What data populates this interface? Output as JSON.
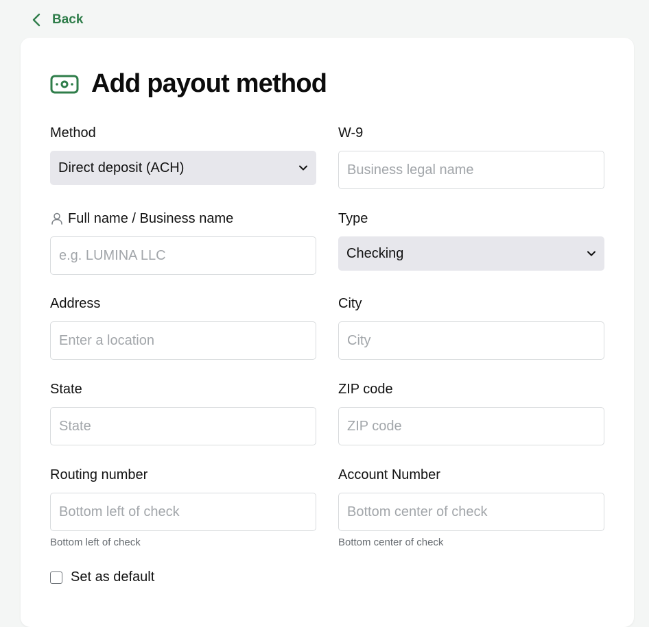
{
  "back": {
    "label": "Back"
  },
  "page": {
    "title": "Add payout method"
  },
  "colors": {
    "accent": "#2f7d4a",
    "select_bg": "#e7e7ec"
  },
  "icons": {
    "back": "chevron-left-icon",
    "title": "money-bill-icon",
    "name_label": "user-icon",
    "select": "chevron-down-icon"
  },
  "form": {
    "method": {
      "label": "Method",
      "value": "Direct deposit (ACH)"
    },
    "w9": {
      "label": "W-9",
      "value": "",
      "placeholder": "Business legal name"
    },
    "full_name": {
      "label": "Full name / Business name",
      "value": "",
      "placeholder": "e.g. LUMINA LLC"
    },
    "type": {
      "label": "Type",
      "value": "Checking"
    },
    "address": {
      "label": "Address",
      "value": "",
      "placeholder": "Enter a location"
    },
    "city": {
      "label": "City",
      "value": "",
      "placeholder": "City"
    },
    "state": {
      "label": "State",
      "value": "",
      "placeholder": "State"
    },
    "zip": {
      "label": "ZIP code",
      "value": "",
      "placeholder": "ZIP code"
    },
    "routing": {
      "label": "Routing number",
      "value": "",
      "placeholder": "Bottom left of check",
      "helper": "Bottom left of check"
    },
    "account": {
      "label": "Account Number",
      "value": "",
      "placeholder": "Bottom center of check",
      "helper": "Bottom center of check"
    },
    "default": {
      "label": "Set as default",
      "checked": false
    }
  }
}
